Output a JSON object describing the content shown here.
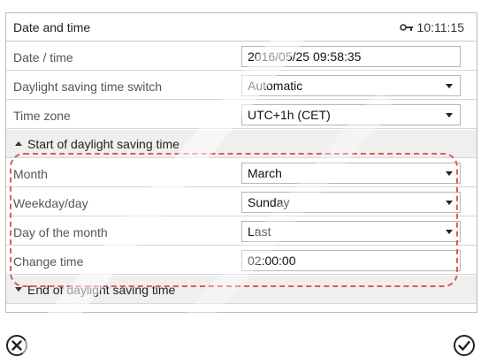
{
  "header": {
    "title": "Date and time",
    "clock_time": "10:11:15",
    "clock_icon": "key-lock-icon"
  },
  "rows": {
    "date_time": {
      "label": "Date / time",
      "value": "2016/05/25 09:58:35"
    },
    "dst_switch": {
      "label": "Daylight saving time switch",
      "value": "Automatic"
    },
    "time_zone": {
      "label": "Time zone",
      "value": "UTC+1h (CET)"
    }
  },
  "start_section": {
    "label": "Start of daylight saving time",
    "expanded": true,
    "month": {
      "label": "Month",
      "value": "March"
    },
    "weekday": {
      "label": "Weekday/day",
      "value": "Sunday"
    },
    "day_of_month": {
      "label": "Day of the month",
      "value": "Last"
    },
    "change_time": {
      "label": "Change time",
      "value": "02:00:00"
    }
  },
  "end_section": {
    "label": "End of daylight saving time",
    "expanded": false
  },
  "footer": {
    "cancel_icon": "cancel-icon",
    "confirm_icon": "confirm-icon"
  },
  "colors": {
    "highlight": "#e05a5a",
    "section_bg": "#efefef"
  }
}
